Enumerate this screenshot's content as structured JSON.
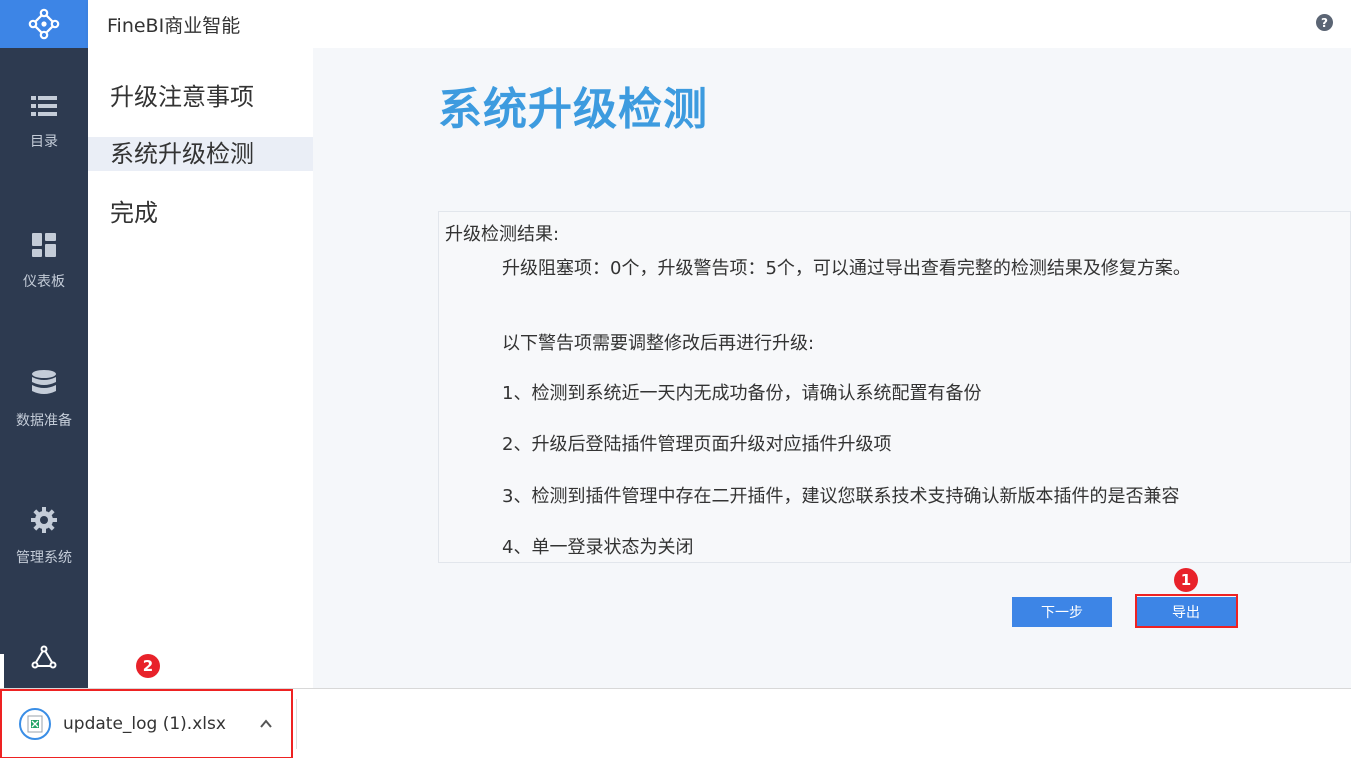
{
  "app": {
    "title": "FineBI商业智能",
    "help_label": "?"
  },
  "rail": {
    "items": [
      {
        "label": "目录",
        "icon": "list-icon"
      },
      {
        "label": "仪表板",
        "icon": "dashboard-icon"
      },
      {
        "label": "数据准备",
        "icon": "database-icon"
      },
      {
        "label": "管理系统",
        "icon": "gear-icon"
      },
      {
        "label": "",
        "icon": "share-nodes-icon"
      }
    ]
  },
  "steps": [
    {
      "label": "升级注意事项",
      "active": false
    },
    {
      "label": "系统升级检测",
      "active": true
    },
    {
      "label": "完成",
      "active": false
    }
  ],
  "main": {
    "title": "系统升级检测",
    "result_heading": "升级检测结果:",
    "summary": "升级阻塞项：0个，升级警告项：5个，可以通过导出查看完整的检测结果及修复方案。",
    "warning_intro": "以下警告项需要调整修改后再进行升级:",
    "warnings": [
      "1、检测到系统近一天内无成功备份，请确认系统配置有备份",
      "2、升级后登陆插件管理页面升级对应插件升级项",
      "3、检测到插件管理中存在二开插件，建议您联系技术支持确认新版本插件的是否兼容",
      "4、单一登录状态为关闭"
    ],
    "next_button": "下一步",
    "export_button": "导出"
  },
  "annotations": {
    "badge1": "1",
    "badge2": "2"
  },
  "download": {
    "filename": "update_log (1).xlsx",
    "chevron": "^"
  },
  "colors": {
    "accent": "#3d85e6",
    "title": "#3d9bdf",
    "rail": "#2d3a50",
    "highlight": "#e22222"
  }
}
